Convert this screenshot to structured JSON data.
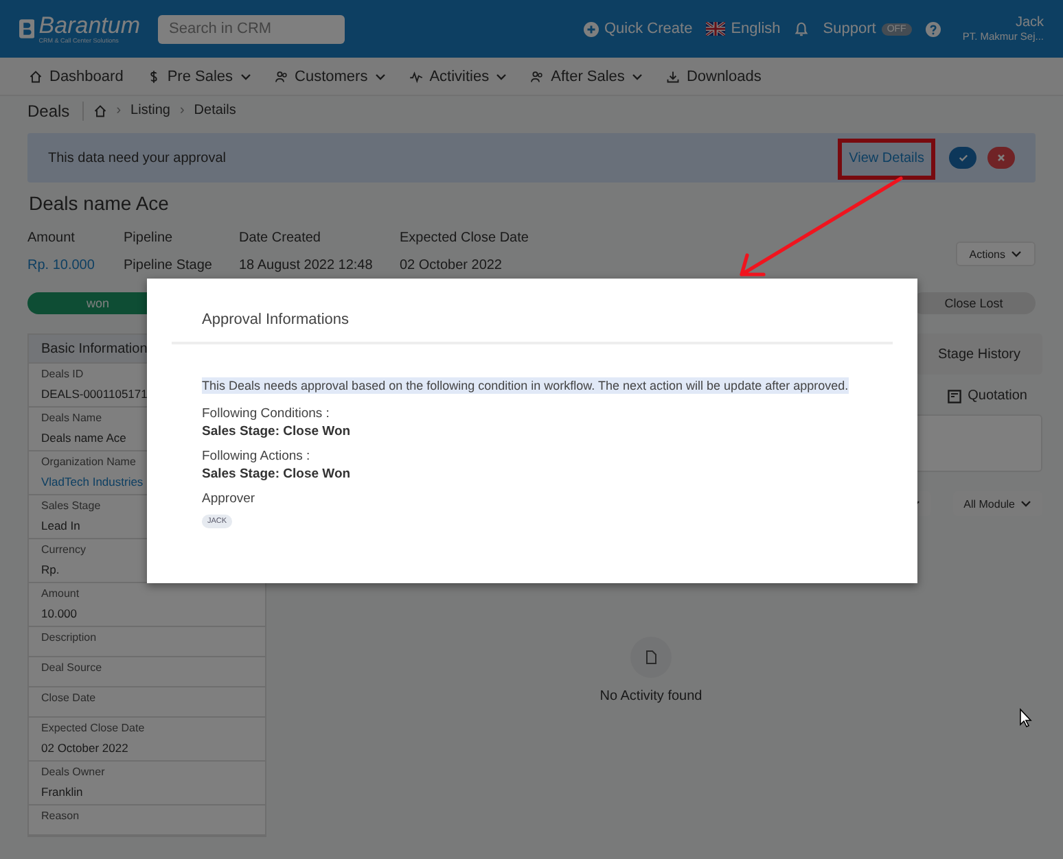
{
  "header": {
    "logo": {
      "name": "Barantum",
      "tagline": "CRM & Call Center Solutions"
    },
    "search": {
      "placeholder": "Search in CRM"
    },
    "quick_create": "Quick Create",
    "language": "English",
    "support": {
      "label": "Support",
      "toggle": "OFF",
      "on": false
    },
    "user": {
      "name": "Jack",
      "company": "PT. Makmur Sej..."
    }
  },
  "nav": [
    {
      "label": "Dashboard",
      "dropdown": false
    },
    {
      "label": "Pre Sales",
      "dropdown": true
    },
    {
      "label": "Customers",
      "dropdown": true
    },
    {
      "label": "Activities",
      "dropdown": true
    },
    {
      "label": "After Sales",
      "dropdown": true
    },
    {
      "label": "Downloads",
      "dropdown": false
    }
  ],
  "breadcrumb": {
    "title": "Deals",
    "items": [
      {
        "separator": "›",
        "label": "Listing"
      },
      {
        "separator": "›",
        "label": "Details"
      }
    ]
  },
  "approval_banner": {
    "message": "This data need your approval",
    "link": "View Details",
    "annotated": true
  },
  "deal": {
    "title": "Deals name Ace",
    "actions": "Actions",
    "fields": [
      {
        "label": "Amount",
        "value": "Rp. 10.000",
        "kind": "link"
      },
      {
        "label": "Pipeline",
        "value": "Pipeline Stage",
        "kind": "text"
      },
      {
        "label": "Date Created",
        "value": "18 August 2022 12:48",
        "kind": "text"
      },
      {
        "label": "Expected Close Date",
        "value": "02 October 2022",
        "kind": "text"
      }
    ]
  },
  "stages": [
    {
      "label": "won",
      "kind": "won"
    },
    {
      "label": "Close Lost",
      "kind": "lost"
    }
  ],
  "basic_info": {
    "title": "Basic Information",
    "fields": [
      {
        "label": "Deals ID",
        "value": "DEALS-0001105171",
        "kind": "text"
      },
      {
        "label": "Deals Name",
        "value": "Deals name Ace",
        "kind": "text"
      },
      {
        "label": "Organization Name",
        "value": "VladTech Industries",
        "kind": "link"
      },
      {
        "label": "Sales Stage",
        "value": "Lead In",
        "kind": "text"
      },
      {
        "label": "Currency",
        "value": "Rp.",
        "kind": "text"
      },
      {
        "label": "Amount",
        "value": "10.000",
        "kind": "text"
      },
      {
        "label": "Description"
      },
      {
        "label": "Deal Source"
      },
      {
        "label": "Close Date"
      },
      {
        "label": "Expected Close Date",
        "value": "02 October 2022",
        "kind": "text"
      },
      {
        "label": "Deals Owner",
        "value": "Franklin",
        "kind": "text"
      },
      {
        "label": "Reason"
      }
    ]
  },
  "side_tabs": [
    {
      "label": "Stage History",
      "kind": "tab"
    },
    {
      "label": "Quotation",
      "kind": "icon-link"
    }
  ],
  "filter": {
    "module": "All Module"
  },
  "empty_state": "No Activity found",
  "modal": {
    "title": "Approval Informations",
    "message": "This Deals needs approval based on the following condition in workflow. The next action will be update after approved.",
    "sections": [
      {
        "label": "Following Conditions :",
        "value": "Sales Stage: Close Won"
      },
      {
        "label": "Following Actions :",
        "value": "Sales Stage: Close Won"
      }
    ],
    "approver_label": "Approver",
    "approvers": [
      "JACK"
    ]
  }
}
